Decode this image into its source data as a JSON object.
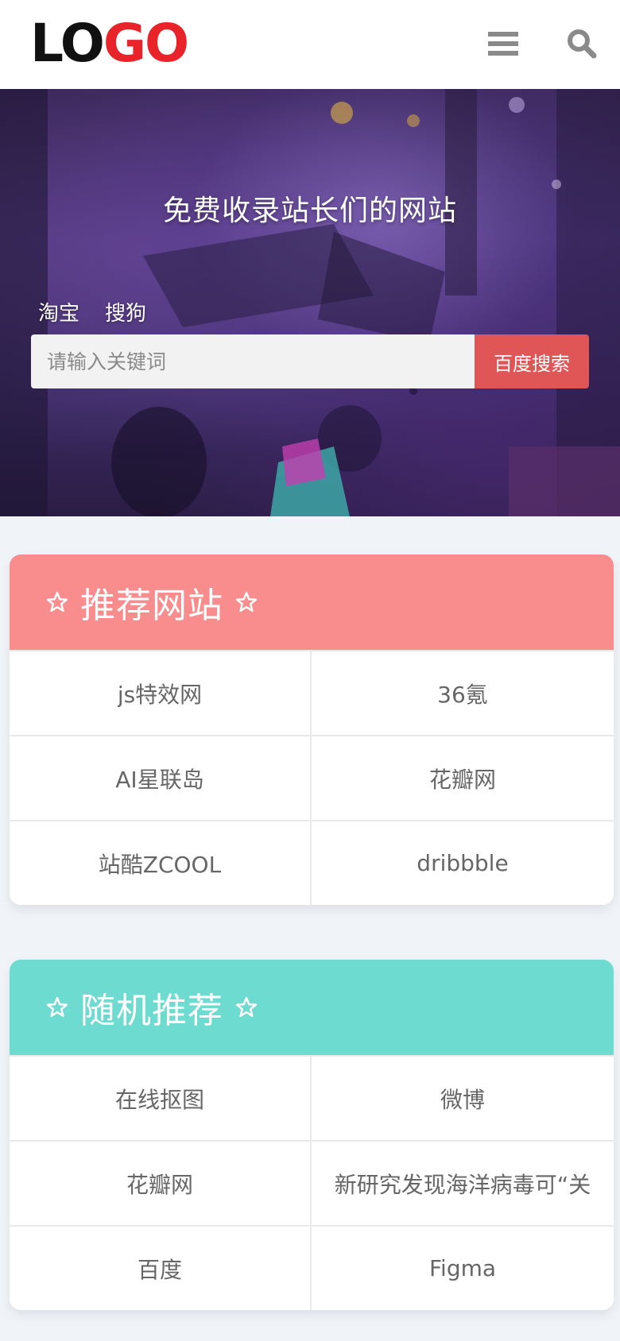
{
  "logo": {
    "black_part": "LO",
    "red_part": "GO"
  },
  "header_icons": {
    "menu": "menu-icon",
    "search": "search-icon"
  },
  "hero": {
    "title": "免费收录站长们的网站",
    "engines": [
      "淘宝",
      "搜狗"
    ],
    "search_placeholder": "请输入关键词",
    "search_button": "百度搜索"
  },
  "sections": [
    {
      "title": "推荐网站",
      "color": "#f98c8c",
      "items": [
        "js特效网",
        "36氪",
        "AI星联岛",
        "花瓣网",
        "站酷ZCOOL",
        "dribbble"
      ]
    },
    {
      "title": "随机推荐",
      "color": "#6ddbd0",
      "items": [
        "在线抠图",
        "微博",
        "花瓣网",
        "新研究发现海洋病毒可“关",
        "百度",
        "Figma"
      ]
    }
  ],
  "colors": {
    "accent_red": "#e05555",
    "logo_red": "#e8232a",
    "page_bg": "#f0f3f7"
  }
}
